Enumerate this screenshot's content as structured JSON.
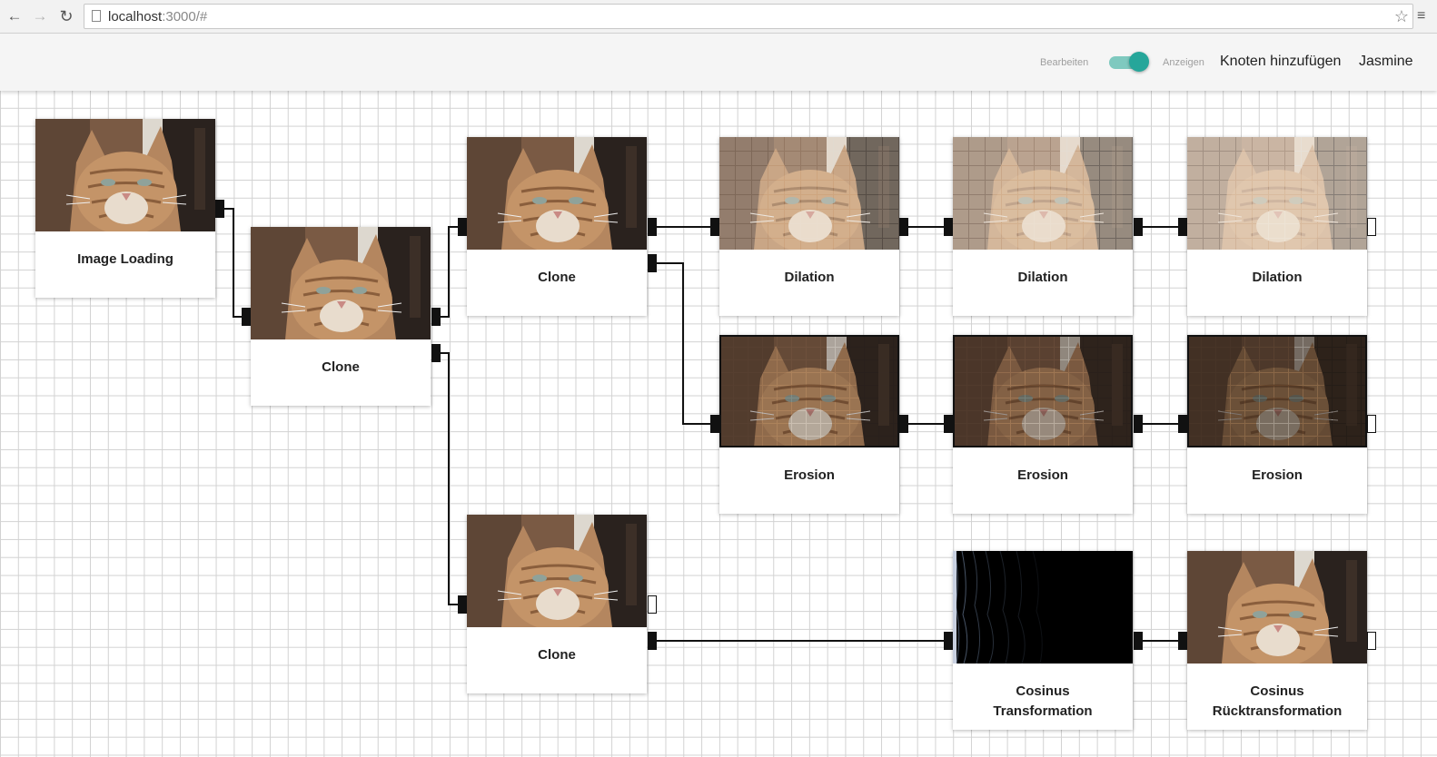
{
  "browser": {
    "url_host": "localhost",
    "url_rest": ":3000/#"
  },
  "header": {
    "mode_edit_label": "Bearbeiten",
    "mode_view_label": "Anzeigen",
    "mode_toggle_on": true,
    "add_node_label": "Knoten hinzufügen",
    "user_name": "Jasmine"
  },
  "colors": {
    "accent": "#26a69a",
    "accent_track": "#7fc9bf"
  },
  "nodes": [
    {
      "title": "Image Loading",
      "image": "cat-original"
    },
    {
      "title": "Clone",
      "image": "cat-original"
    },
    {
      "title": "Clone",
      "image": "cat-original"
    },
    {
      "title": "Dilation",
      "image": "cat-dilated-1"
    },
    {
      "title": "Dilation",
      "image": "cat-dilated-2"
    },
    {
      "title": "Dilation",
      "image": "cat-dilated-3"
    },
    {
      "title": "Erosion",
      "image": "cat-eroded-1"
    },
    {
      "title": "Erosion",
      "image": "cat-eroded-2"
    },
    {
      "title": "Erosion",
      "image": "cat-eroded-3"
    },
    {
      "title": "Clone",
      "image": "cat-original"
    },
    {
      "title_line1": "Cosinus",
      "title_line2": "Transformation",
      "image": "dct-spectrum"
    },
    {
      "title_line1": "Cosinus",
      "title_line2": "Rücktransformation",
      "image": "cat-original"
    }
  ]
}
